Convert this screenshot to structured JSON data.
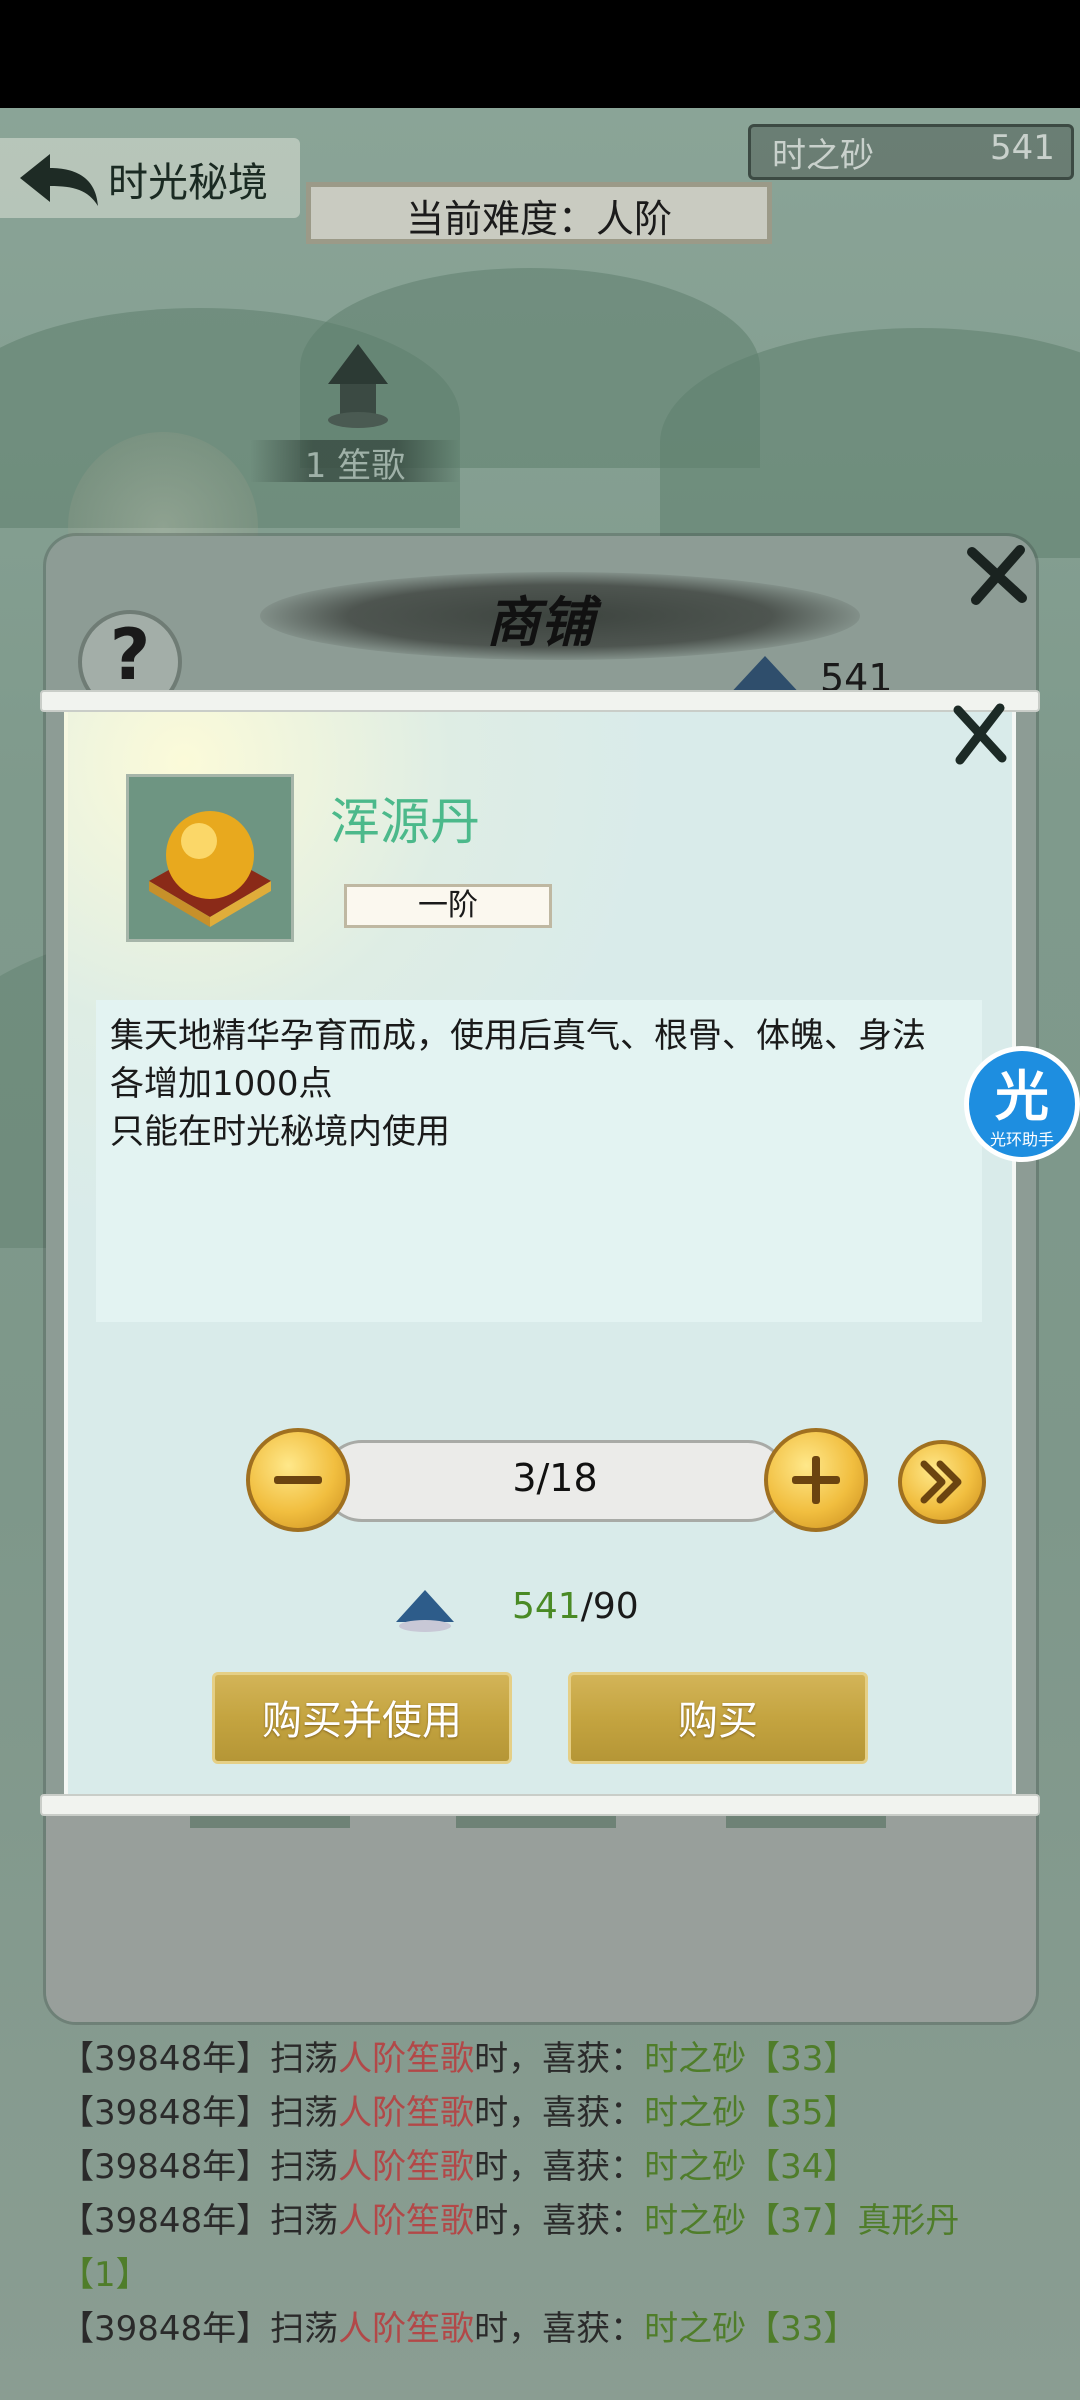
{
  "header": {
    "title": "时光秘境",
    "currency": {
      "label": "时之砂",
      "value": "541"
    },
    "difficulty": "当前难度：人阶"
  },
  "map": {
    "node_label": "1 笙歌"
  },
  "shop": {
    "title": "商铺",
    "help": "?",
    "currency_value": "541"
  },
  "item_popup": {
    "name": "浑源丹",
    "tier": "一阶",
    "description": [
      "集天地精华孕育而成，使用后真气、根骨、体魄、身法",
      "各增加1000点",
      "只能在时光秘境内使用"
    ],
    "quantity": "3/18",
    "cost": {
      "have": "541",
      "need": "/90"
    },
    "buttons": {
      "buy_and_use": "购买并使用",
      "buy": "购买"
    }
  },
  "assistant": {
    "big": "光",
    "small": "光环助手"
  },
  "log": [
    {
      "prefix": "【39848年】扫荡",
      "place": "人阶笙歌",
      "mid": "时，喜获：",
      "reward": "时之砂【33】"
    },
    {
      "prefix": "【39848年】扫荡",
      "place": "人阶笙歌",
      "mid": "时，喜获：",
      "reward": "时之砂【35】"
    },
    {
      "prefix": "【39848年】扫荡",
      "place": "人阶笙歌",
      "mid": "时，喜获：",
      "reward": "时之砂【34】"
    },
    {
      "prefix": "【39848年】扫荡",
      "place": "人阶笙歌",
      "mid": "时，喜获：",
      "reward": "时之砂【37】真形丹"
    },
    {
      "prefix": "【1】",
      "place": "",
      "mid": "",
      "reward": ""
    },
    {
      "prefix": "【39848年】扫荡",
      "place": "人阶笙歌",
      "mid": "时，喜获：",
      "reward": "时之砂【33】"
    }
  ],
  "colors": {
    "item_name": "#4cb98b",
    "cost_have": "#4a8a25",
    "log_place": "#b24848",
    "log_reward": "#4f7d2a",
    "gold_button": "#c4a440"
  }
}
